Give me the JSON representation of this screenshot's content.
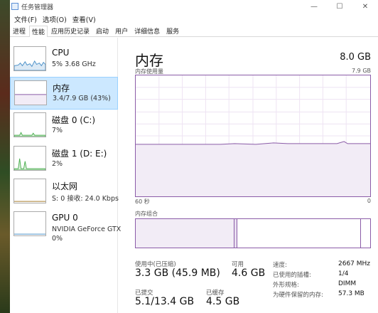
{
  "window": {
    "title": "任务管理器"
  },
  "window_controls": {
    "minimize": "—",
    "maximize": "☐",
    "close": "✕"
  },
  "menu": [
    "文件(F)",
    "选项(O)",
    "查看(V)"
  ],
  "tabs": [
    "进程",
    "性能",
    "应用历史记录",
    "启动",
    "用户",
    "详细信息",
    "服务"
  ],
  "active_tab": "性能",
  "sidebar": {
    "items": [
      {
        "name": "CPU",
        "value": "5% 3.68 GHz",
        "color": "#4a90c8"
      },
      {
        "name": "内存",
        "value": "3.4/7.9 GB (43%)",
        "color": "#8b5ca8"
      },
      {
        "name": "磁盘 0 (C:)",
        "value": "7%",
        "color": "#4caf50"
      },
      {
        "name": "磁盘 1 (D: E:)",
        "value": "2%",
        "color": "#4caf50"
      },
      {
        "name": "以太网",
        "value": "S: 0 接收: 24.0 Kbps",
        "color": "#a67c2e"
      },
      {
        "name": "GPU 0",
        "value": "NVIDIA GeForce GTX",
        "value2": "0%",
        "color": "#4a90c8"
      }
    ]
  },
  "main": {
    "title": "内存",
    "total": "8.0 GB",
    "usage_label": "内存使用量",
    "usage_max": "7.9 GB",
    "time_left": "60 秒",
    "time_right": "0",
    "composition_label": "内存组合",
    "usage_fraction": 0.43,
    "accent_color": "#8b5ca8"
  },
  "stats": {
    "in_use_label": "使用中(已压缩)",
    "in_use_value": "3.3 GB (45.9 MB)",
    "available_label": "可用",
    "available_value": "4.6 GB",
    "committed_label": "已提交",
    "committed_value": "5.1/13.4 GB",
    "cached_label": "已缓存",
    "cached_value": "4.5 GB"
  },
  "specs": [
    {
      "label": "速度:",
      "value": "2667 MHz"
    },
    {
      "label": "已使用的插槽:",
      "value": "1/4"
    },
    {
      "label": "外形规格:",
      "value": "DIMM"
    },
    {
      "label": "为硬件保留的内存:",
      "value": "57.3 MB"
    }
  ]
}
